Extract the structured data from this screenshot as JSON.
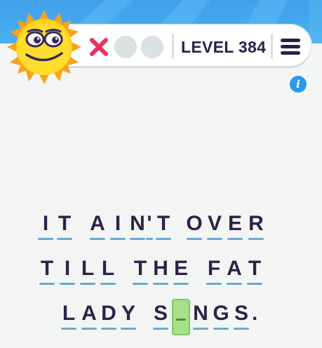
{
  "header": {
    "level_label": "LEVEL 384",
    "mistakes_used": 1,
    "lives_total": 3
  },
  "colors": {
    "sky": "#3fa0ea",
    "mistake": "#e8325e",
    "text": "#2e1d4a",
    "active_tile": "#a8df8a"
  },
  "puzzle": {
    "lines": [
      [
        "IT",
        "AIN'T",
        "OVER"
      ],
      [
        "TILL",
        "THE",
        "FAT"
      ],
      [
        "LADY",
        "SINGS."
      ]
    ],
    "letters": {
      "l1w1": [
        "I",
        "T"
      ],
      "l1w2": [
        "A",
        "I",
        "N",
        "'",
        "T"
      ],
      "l1w3": [
        "O",
        "V",
        "E",
        "R"
      ],
      "l2w1": [
        "T",
        "I",
        "L",
        "L"
      ],
      "l2w2": [
        "T",
        "H",
        "E"
      ],
      "l2w3": [
        "F",
        "A",
        "T"
      ],
      "l3w1": [
        "L",
        "A",
        "D",
        "Y"
      ],
      "l3w2": [
        "S",
        "",
        "N",
        "G",
        "S"
      ],
      "l3w2_end": "."
    },
    "active_cell": "SINGS letter 2 (empty)"
  }
}
